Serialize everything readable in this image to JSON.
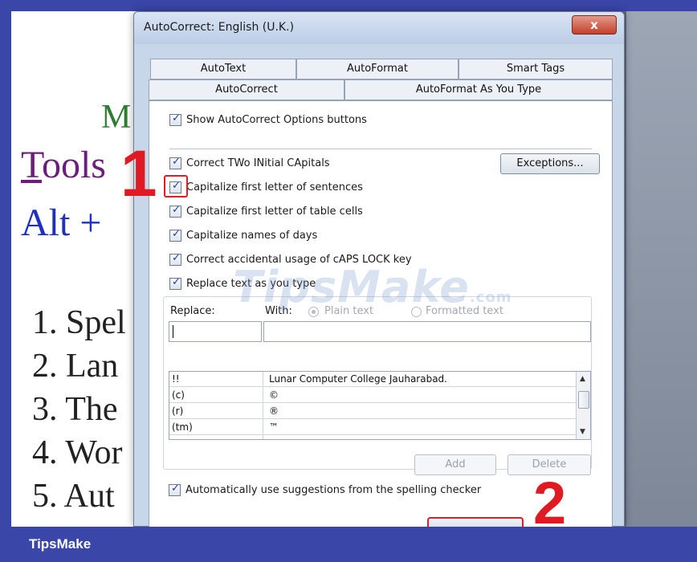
{
  "document": {
    "heading_m": "M",
    "tools_first": "T",
    "tools_rest": "ools",
    "alt": "Alt +",
    "list": [
      "1. Spel",
      "2. Lan",
      "3. The",
      "4. Wor",
      "5. Aut"
    ]
  },
  "dialog": {
    "title": "AutoCorrect: English (U.K.)",
    "close_label": "x",
    "tabs_back": [
      "AutoText",
      "AutoFormat",
      "Smart Tags"
    ],
    "tabs_front": [
      "AutoCorrect",
      "AutoFormat As You Type"
    ],
    "show_options": "Show AutoCorrect Options buttons",
    "options": [
      "Correct TWo INitial CApitals",
      "Capitalize first letter of sentences",
      "Capitalize first letter of table cells",
      "Capitalize names of days",
      "Correct accidental usage of cAPS LOCK key",
      "Replace text as you type"
    ],
    "exceptions_label": "Exceptions...",
    "replace_label": "Replace:",
    "with_label": "With:",
    "plain_text_label": "Plain text",
    "formatted_text_label": "Formatted text",
    "entries": [
      {
        "key": "!!",
        "value": "Lunar Computer College Jauharabad."
      },
      {
        "key": "(c)",
        "value": "©"
      },
      {
        "key": "(r)",
        "value": "®"
      },
      {
        "key": "(tm)",
        "value": "™"
      }
    ],
    "add_label": "Add",
    "delete_label": "Delete",
    "auto_suggest": "Automatically use suggestions from the spelling checker"
  },
  "annotations": {
    "step1": "1",
    "step2": "2"
  },
  "watermark": "TipsMake",
  "watermark_suffix": ".com",
  "footer_brand": "TipsMake",
  "colors": {
    "frame": "#3a46a8",
    "highlight": "#d8202a"
  }
}
